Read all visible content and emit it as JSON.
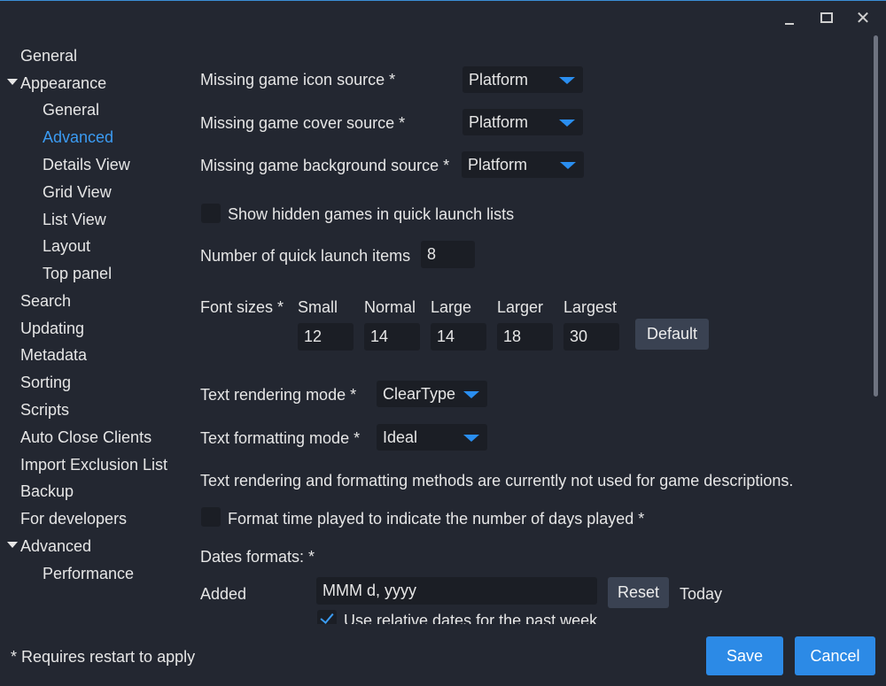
{
  "window": {
    "minimize_icon": "minimize-icon",
    "maximize_icon": "maximize-icon",
    "close_icon": "close-icon",
    "close_glyph": "✕"
  },
  "sidebar": {
    "items": [
      {
        "label": "General",
        "level": 0
      },
      {
        "label": "Appearance",
        "level": 0,
        "expanded": true
      },
      {
        "label": "General",
        "level": 1
      },
      {
        "label": "Advanced",
        "level": 1,
        "active": true
      },
      {
        "label": "Details View",
        "level": 1
      },
      {
        "label": "Grid View",
        "level": 1
      },
      {
        "label": "List View",
        "level": 1
      },
      {
        "label": "Layout",
        "level": 1
      },
      {
        "label": "Top panel",
        "level": 1
      },
      {
        "label": "Search",
        "level": 0
      },
      {
        "label": "Updating",
        "level": 0
      },
      {
        "label": "Metadata",
        "level": 0
      },
      {
        "label": "Sorting",
        "level": 0
      },
      {
        "label": "Scripts",
        "level": 0
      },
      {
        "label": "Auto Close Clients",
        "level": 0
      },
      {
        "label": "Import Exclusion List",
        "level": 0
      },
      {
        "label": "Backup",
        "level": 0
      },
      {
        "label": "For developers",
        "level": 0
      },
      {
        "label": "Advanced",
        "level": 0,
        "expanded": true
      },
      {
        "label": "Performance",
        "level": 1
      }
    ]
  },
  "settings": {
    "icon_source": {
      "label": "Missing game icon source *",
      "value": "Platform"
    },
    "cover_source": {
      "label": "Missing game cover source *",
      "value": "Platform"
    },
    "background_source": {
      "label": "Missing game background source *",
      "value": "Platform"
    },
    "show_hidden": {
      "label": "Show hidden games in quick launch lists",
      "checked": false
    },
    "quick_launch": {
      "label": "Number of quick launch items",
      "value": "8"
    },
    "font_sizes": {
      "label": "Font sizes *",
      "columns": [
        {
          "label": "Small",
          "value": "12"
        },
        {
          "label": "Normal",
          "value": "14"
        },
        {
          "label": "Large",
          "value": "14"
        },
        {
          "label": "Larger",
          "value": "18"
        },
        {
          "label": "Largest",
          "value": "30"
        }
      ],
      "default_button": "Default"
    },
    "text_rendering": {
      "label": "Text rendering mode *",
      "value": "ClearType"
    },
    "text_formatting": {
      "label": "Text formatting mode *",
      "value": "Ideal"
    },
    "note": "Text rendering and formatting methods are currently not used for game descriptions.",
    "format_time": {
      "label": "Format time played to indicate the number of days played *",
      "checked": false
    },
    "dates": {
      "label": "Dates formats: *",
      "added_label": "Added",
      "added_value": "MMM d, yyyy",
      "reset_button": "Reset",
      "preview": "Today",
      "relative_label": "Use relative dates for the past week",
      "relative_checked": true
    }
  },
  "footer": {
    "note": "* Requires restart to apply",
    "save": "Save",
    "cancel": "Cancel"
  },
  "colors": {
    "background": "#232731",
    "accent": "#2c8ae6",
    "active_nav": "#3b9bf2"
  }
}
